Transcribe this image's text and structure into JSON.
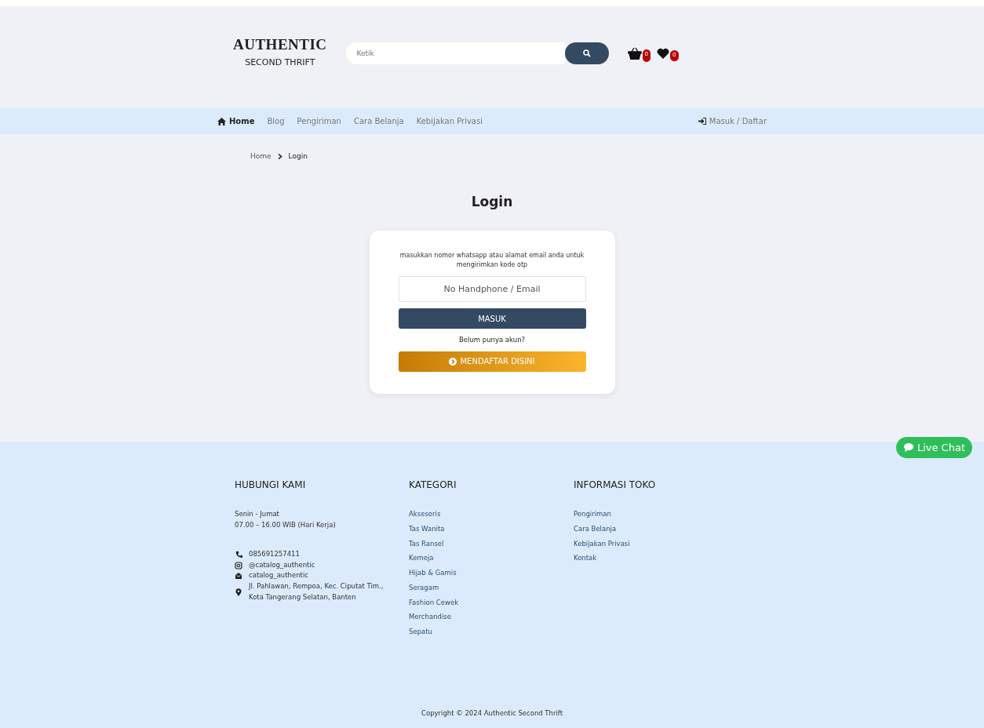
{
  "header": {
    "logo_title": "AUTHENTIC",
    "logo_subtitle": "SECOND THRIFT",
    "search": {
      "placeholder": "Ketik"
    },
    "cart_count": "0",
    "wishlist_count": "0"
  },
  "nav": {
    "items": [
      {
        "label": "Home",
        "selected": true,
        "kind": "home"
      },
      {
        "label": "Blog",
        "selected": false
      },
      {
        "label": "Pengiriman",
        "selected": false
      },
      {
        "label": "Cara Belanja",
        "selected": false
      },
      {
        "label": "Kebijakan Privasi",
        "selected": false
      }
    ],
    "login": "Masuk / Daftar"
  },
  "breadcrumb": [
    "Home",
    "Login"
  ],
  "login": {
    "title": "Login",
    "instruction": "masukkan nomor whatsapp atau alamat email anda untuk mengirimkan kode otp",
    "field": {
      "placeholder": "No Handphone / Email"
    },
    "submit": "MASUK",
    "register_prompt": "Belum punya akun?",
    "register": "MENDAFTAR DISINI"
  },
  "live_chat": "Live Chat",
  "footer": {
    "contact": {
      "title": "HUBUNGI KAMI",
      "hours": [
        "Senin - Jumat",
        "07.00 – 16.00 WIB (Hari Kerja)"
      ],
      "items": [
        {
          "kind": "phone",
          "text": "085691257411"
        },
        {
          "kind": "instagram",
          "text": "@catalog_authentic"
        },
        {
          "kind": "mail",
          "text": "catalog_authentic"
        },
        {
          "kind": "location",
          "text": "Jl. Pahlawan, Rempoa, Kec. Ciputat Tim., Kota Tangerang Selatan, Banten"
        }
      ]
    },
    "categories": {
      "title": "KATEGORI",
      "links": [
        "Aksesoris",
        "Tas Wanita",
        "Tas Ransel",
        "Kemeja",
        "Hijab & Gamis",
        "Seragam",
        "Fashion Cewek",
        "Merchandise",
        "Sepatu"
      ]
    },
    "info": {
      "title": "INFORMASI TOKO",
      "links": [
        "Pengiriman",
        "Cara Belanja",
        "Kebijakan Privasi",
        "Kontak"
      ]
    },
    "copyright": "Copyright © 2024 Authentic Second Thrift"
  }
}
